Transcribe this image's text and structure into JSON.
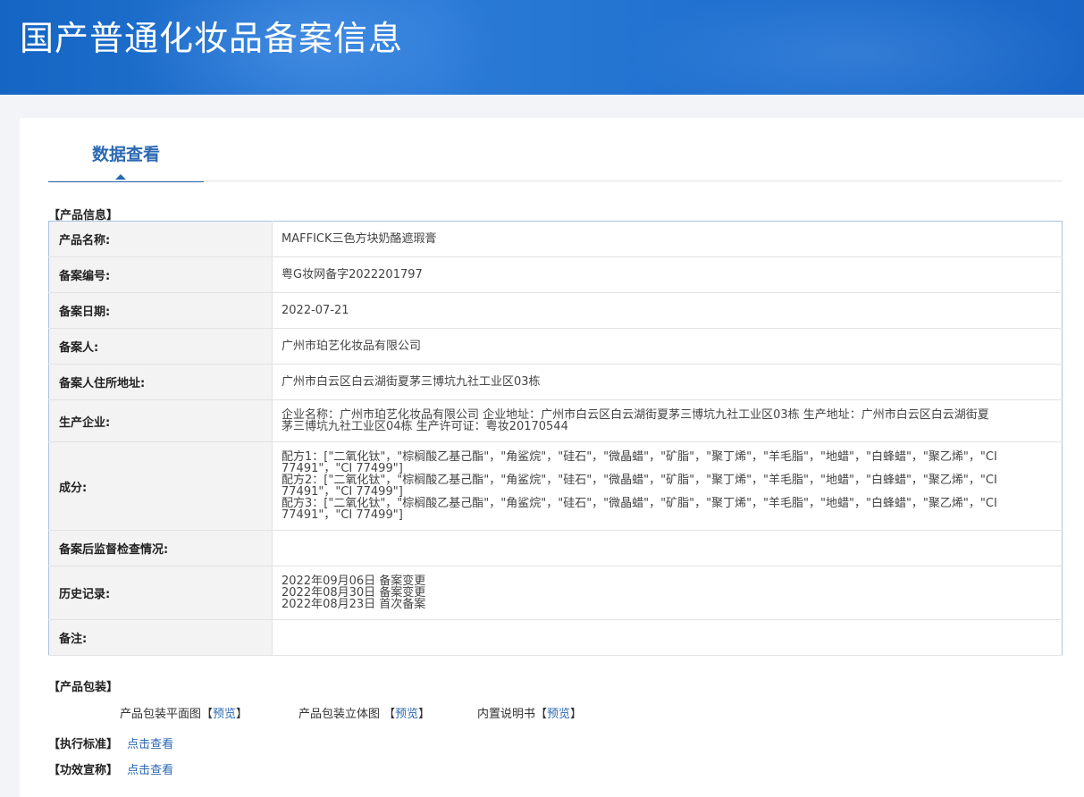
{
  "header": {
    "title": "国产普通化妆品备案信息"
  },
  "tabs": [
    {
      "label": "数据查看"
    }
  ],
  "sections": {
    "product_info": "【产品信息】",
    "packaging": "【产品包装】",
    "standard": "【执行标准】",
    "efficacy": "【功效宣称】"
  },
  "product": {
    "rows": [
      {
        "label": "产品名称:",
        "value": "MAFFICK三色方块奶酪遮瑕膏"
      },
      {
        "label": "备案编号:",
        "value": "粤G妆网备字2022201797"
      },
      {
        "label": "备案日期:",
        "value": "2022-07-21"
      },
      {
        "label": "备案人:",
        "value": "广州市珀艺化妆品有限公司"
      },
      {
        "label": "备案人住所地址:",
        "value": "广州市白云区白云湖街夏茅三博坑九社工业区03栋"
      },
      {
        "label": "生产企业:",
        "lines": [
          "企业名称：广州市珀艺化妆品有限公司 企业地址：广州市白云区白云湖街夏茅三博坑九社工业区03栋 生产地址：广州市白云区白云湖街夏",
          "茅三博坑九社工业区04栋 生产许可证：粤妆20170544"
        ]
      },
      {
        "label": "成分:",
        "lines": [
          "配方1：[\"二氧化钛\"，\"棕榈酸乙基己酯\"，\"角鲨烷\"，\"硅石\"，\"微晶蜡\"，\"矿脂\"，\"聚丁烯\"，\"羊毛脂\"，\"地蜡\"，\"白蜂蜡\"，\"聚乙烯\"，\"CI",
          "77491\"，\"CI 77499\"]",
          "配方2：[\"二氧化钛\"，\"棕榈酸乙基己酯\"，\"角鲨烷\"，\"硅石\"，\"微晶蜡\"，\"矿脂\"，\"聚丁烯\"，\"羊毛脂\"，\"地蜡\"，\"白蜂蜡\"，\"聚乙烯\"，\"CI",
          "77491\"，\"CI 77499\"]",
          "配方3：[\"二氧化钛\"，\"棕榈酸乙基己酯\"，\"角鲨烷\"，\"硅石\"，\"微晶蜡\"，\"矿脂\"，\"聚丁烯\"，\"羊毛脂\"，\"地蜡\"，\"白蜂蜡\"，\"聚乙烯\"，\"CI",
          "77491\"，\"CI 77499\"]"
        ]
      },
      {
        "label": "备案后监督检查情况:",
        "value": ""
      },
      {
        "label": "历史记录:",
        "lines": [
          "2022年09月06日 备案变更",
          "2022年08月30日 备案变更",
          "2022年08月23日 首次备案"
        ]
      },
      {
        "label": "备注:",
        "value": ""
      }
    ]
  },
  "packaging": {
    "items": [
      {
        "label": "产品包装平面图【",
        "link": "预览",
        "close": "】"
      },
      {
        "label": "产品包装立体图 【",
        "link": "预览",
        "close": "】"
      },
      {
        "label": "内置说明书【",
        "link": "预览",
        "close": "】"
      }
    ]
  },
  "links": {
    "view": "点击查看"
  }
}
